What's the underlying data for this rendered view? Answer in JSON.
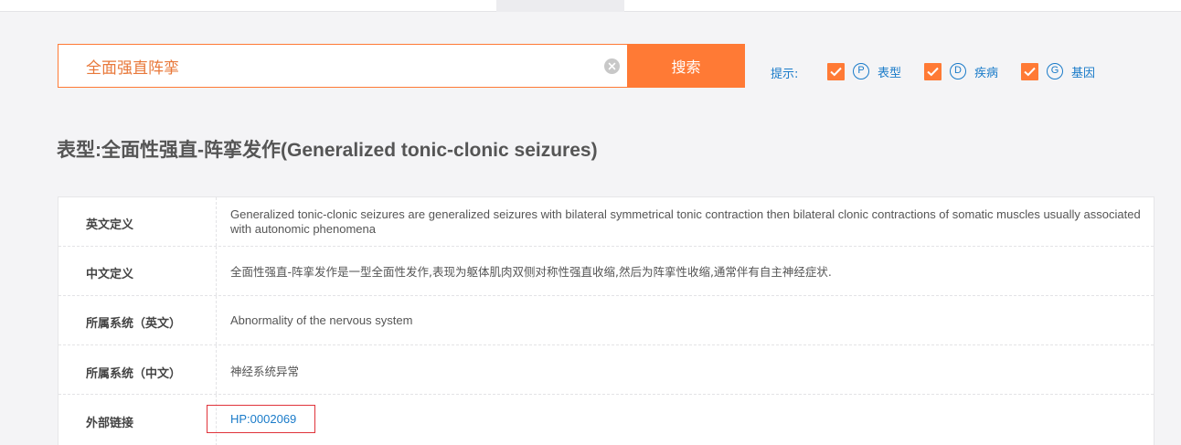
{
  "search": {
    "value": "全面强直阵挛",
    "button_label": "搜索"
  },
  "filters": {
    "hint_label": "提示:",
    "items": [
      {
        "letter": "P",
        "label": "表型",
        "checked": true
      },
      {
        "letter": "D",
        "label": "疾病",
        "checked": true
      },
      {
        "letter": "G",
        "label": "基因",
        "checked": true
      }
    ]
  },
  "title": "表型:全面性强直-阵挛发作(Generalized tonic-clonic seizures)",
  "details": {
    "english_definition": {
      "label": "英文定义",
      "value": "Generalized tonic-clonic seizures are generalized seizures with bilateral symmetrical tonic contraction then bilateral clonic contractions of somatic muscles usually associated with autonomic phenomena"
    },
    "chinese_definition": {
      "label": "中文定义",
      "value": "全面性强直-阵挛发作是一型全面性发作,表现为躯体肌肉双侧对称性强直收缩,然后为阵挛性收缩,通常伴有自主神经症状."
    },
    "system_en": {
      "label": "所属系统（英文）",
      "value": "Abnormality of the nervous system"
    },
    "system_cn": {
      "label": "所属系统（中文）",
      "value": "神经系统异常"
    },
    "external_link": {
      "label": "外部链接",
      "value": "HP:0002069"
    }
  },
  "colors": {
    "accent": "#ff7a35",
    "link": "#1a7bc9",
    "highlight_border": "#e0333a",
    "background": "#f4f4f6"
  }
}
